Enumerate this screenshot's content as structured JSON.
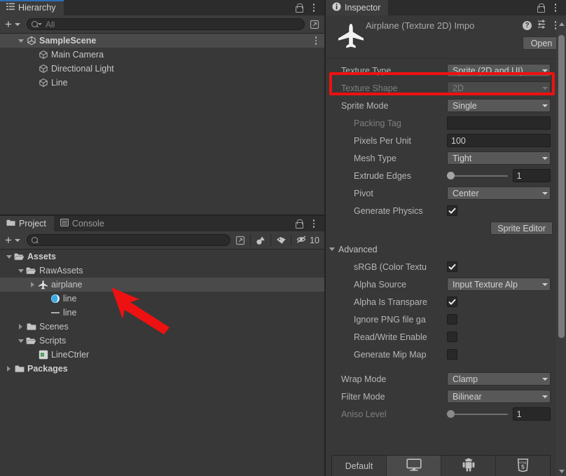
{
  "hierarchy": {
    "tab_label": "Hierarchy",
    "tab_icon": "hierarchy-icon",
    "lock_icon": "lock-icon",
    "menu_icon": "kebab-menu-icon",
    "create_label": "+",
    "search_placeholder": "All",
    "search_value": "",
    "items": [
      {
        "label": "SampleScene",
        "icon": "unity-scene-icon",
        "indent": 1,
        "twisty": "down",
        "selected": true,
        "bold": true
      },
      {
        "label": "Main Camera",
        "icon": "gameobject-cube-icon",
        "indent": 2,
        "twisty": "none",
        "selected": false,
        "bold": false
      },
      {
        "label": "Directional Light",
        "icon": "gameobject-cube-icon",
        "indent": 2,
        "twisty": "none",
        "selected": false,
        "bold": false
      },
      {
        "label": "Line",
        "icon": "gameobject-cube-icon",
        "indent": 2,
        "twisty": "none",
        "selected": false,
        "bold": false
      }
    ]
  },
  "project": {
    "tabs": [
      {
        "label": "Project",
        "icon": "folder-icon",
        "active": true
      },
      {
        "label": "Console",
        "icon": "console-icon",
        "active": false
      }
    ],
    "lock_icon": "lock-icon",
    "menu_icon": "kebab-menu-icon",
    "create_label": "+",
    "search_placeholder": "",
    "search_value": "",
    "toolbar_icons": [
      "search-expand-icon",
      "filter-by-type-icon",
      "filter-by-label-icon"
    ],
    "hidden_toggle_icon": "hidden-eye-icon",
    "hidden_count": "10",
    "items": [
      {
        "label": "Assets",
        "icon": "folder-open-icon",
        "indent": 0,
        "twisty": "down",
        "selected": false,
        "bold": true
      },
      {
        "label": "RawAssets",
        "icon": "folder-open-icon",
        "indent": 1,
        "twisty": "down",
        "selected": false,
        "bold": false
      },
      {
        "label": "airplane",
        "icon": "airplane-sprite-icon",
        "indent": 2,
        "twisty": "right",
        "selected": true,
        "bold": false
      },
      {
        "label": "line",
        "icon": "material-sphere-icon",
        "indent": 3,
        "twisty": "none",
        "selected": false,
        "bold": false
      },
      {
        "label": "line",
        "icon": "line-dash-icon",
        "indent": 3,
        "twisty": "none",
        "selected": false,
        "bold": false
      },
      {
        "label": "Scenes",
        "icon": "folder-icon",
        "indent": 1,
        "twisty": "right",
        "selected": false,
        "bold": false
      },
      {
        "label": "Scripts",
        "icon": "folder-open-icon",
        "indent": 1,
        "twisty": "down",
        "selected": false,
        "bold": false
      },
      {
        "label": "LineCtrler",
        "icon": "csharp-script-icon",
        "indent": 2,
        "twisty": "none",
        "selected": false,
        "bold": false
      },
      {
        "label": "Packages",
        "icon": "folder-icon",
        "indent": 0,
        "twisty": "right",
        "selected": false,
        "bold": true
      }
    ]
  },
  "inspector": {
    "tab_label": "Inspector",
    "tab_icon": "info-icon",
    "lock_icon": "lock-icon",
    "menu_icon": "kebab-menu-icon",
    "asset_title": "Airplane (Texture 2D) Impo",
    "asset_icon": "airplane-preview-icon",
    "help_icon": "help-icon",
    "preset_icon": "preset-settings-icon",
    "header_menu_icon": "kebab-menu-icon",
    "open_button": "Open",
    "properties": [
      {
        "label": "Texture Type",
        "type": "dropdown",
        "value": "Sprite (2D and UI)",
        "disabled": false,
        "highlighted": true
      },
      {
        "label": "Texture Shape",
        "type": "dropdown",
        "value": "2D",
        "disabled": true,
        "highlighted": false
      },
      {
        "label": "Sprite Mode",
        "type": "dropdown",
        "value": "Single",
        "disabled": false,
        "highlighted": false
      },
      {
        "label": "Packing Tag",
        "type": "text",
        "value": "",
        "disabled": true,
        "highlighted": false
      },
      {
        "label": "Pixels Per Unit",
        "type": "text",
        "value": "100",
        "disabled": false,
        "highlighted": false
      },
      {
        "label": "Mesh Type",
        "type": "dropdown",
        "value": "Tight",
        "disabled": false,
        "highlighted": false
      },
      {
        "label": "Extrude Edges",
        "type": "slider",
        "value": "1",
        "disabled": false,
        "highlighted": false
      },
      {
        "label": "Pivot",
        "type": "dropdown",
        "value": "Center",
        "disabled": false,
        "highlighted": false
      },
      {
        "label": "Generate Physics",
        "type": "checkbox",
        "value": "checked",
        "disabled": false,
        "highlighted": false
      }
    ],
    "sprite_editor_button": "Sprite Editor",
    "advanced_label": "Advanced",
    "advanced_properties": [
      {
        "label": "sRGB (Color Textu",
        "type": "checkbox",
        "value": "checked",
        "disabled": false
      },
      {
        "label": "Alpha Source",
        "type": "dropdown",
        "value": "Input Texture Alp",
        "disabled": false
      },
      {
        "label": "Alpha Is Transpare",
        "type": "checkbox",
        "value": "checked",
        "disabled": false
      },
      {
        "label": "Ignore PNG file ga",
        "type": "checkbox",
        "value": "unchecked",
        "disabled": false
      },
      {
        "label": "Read/Write Enable",
        "type": "checkbox",
        "value": "unchecked",
        "disabled": false
      },
      {
        "label": "Generate Mip Map",
        "type": "checkbox",
        "value": "unchecked",
        "disabled": false
      }
    ],
    "filter_properties": [
      {
        "label": "Wrap Mode",
        "type": "dropdown",
        "value": "Clamp",
        "disabled": false
      },
      {
        "label": "Filter Mode",
        "type": "dropdown",
        "value": "Bilinear",
        "disabled": false
      },
      {
        "label": "Aniso Level",
        "type": "slider",
        "value": "1",
        "disabled": true
      }
    ],
    "platform_tabs": [
      {
        "label": "Default",
        "icon": "",
        "active": false
      },
      {
        "label": "",
        "icon": "standalone-icon",
        "active": true
      },
      {
        "label": "",
        "icon": "android-icon",
        "active": false
      },
      {
        "label": "",
        "icon": "html5-icon",
        "active": false
      }
    ]
  },
  "annotation": {
    "highlight_color": "#ee1111",
    "arrow_name": "red-arrow-pointer"
  }
}
